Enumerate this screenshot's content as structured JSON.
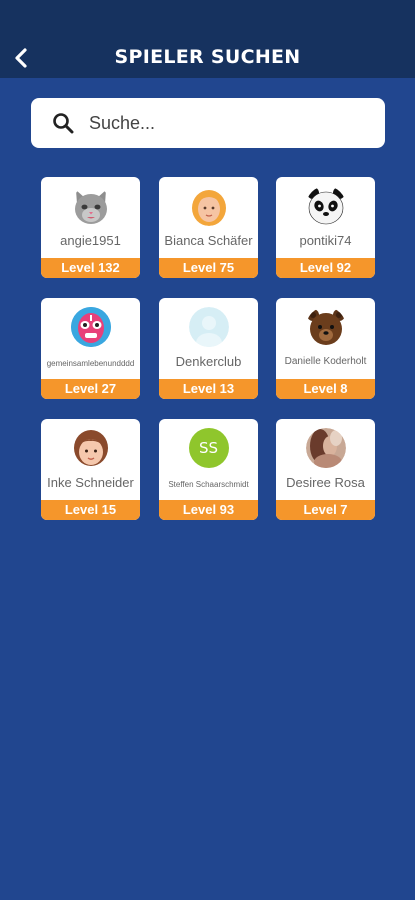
{
  "header": {
    "title": "SPIELER SUCHEN",
    "back_icon": "chevron-left-icon"
  },
  "search": {
    "placeholder": "Suche...",
    "value": "",
    "icon": "search-icon"
  },
  "colors": {
    "background": "#21468f",
    "header": "#16325f",
    "level_bar": "#f5962b"
  },
  "players": [
    {
      "name": "angie1951",
      "level": "Level 132",
      "avatar": "cat-avatar-icon"
    },
    {
      "name": "Bianca Schäfer",
      "level": "Level 75",
      "avatar": "blonde-woman-avatar-icon"
    },
    {
      "name": "pontiki74",
      "level": "Level 92",
      "avatar": "panda-avatar-icon"
    },
    {
      "name": "gemeinsamlebenundddd",
      "level": "Level 27",
      "avatar": "wrestler-mask-avatar-icon"
    },
    {
      "name": "Denkerclub",
      "level": "Level 13",
      "avatar": "default-user-avatar-icon"
    },
    {
      "name": "Danielle Koderholt",
      "level": "Level 8",
      "avatar": "bear-avatar-icon"
    },
    {
      "name": "Inke Schneider",
      "level": "Level 15",
      "avatar": "brown-hair-woman-avatar-icon"
    },
    {
      "name": "Steffen Schaarschmidt",
      "level": "Level 93",
      "avatar": "initials-avatar",
      "initials": "SS"
    },
    {
      "name": "Desiree Rosa",
      "level": "Level 7",
      "avatar": "photo-avatar"
    }
  ]
}
